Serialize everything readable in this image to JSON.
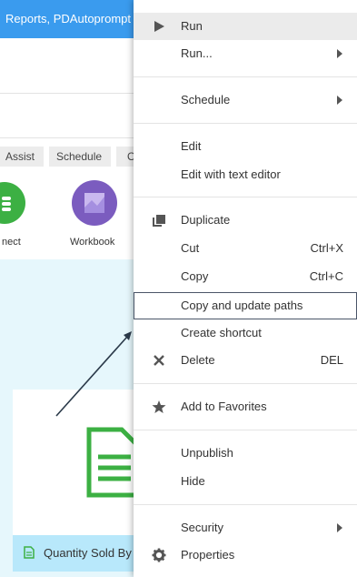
{
  "background": {
    "title": "Reports, PDAutoprompt",
    "chips": [
      "Assist",
      "Schedule",
      "O"
    ],
    "tiles": [
      {
        "label": "nect",
        "icon": "green-circle-icon",
        "color": "#3cb043"
      },
      {
        "label": "Workbook",
        "icon": "workbook-icon",
        "color": "#7b5cbf"
      }
    ],
    "card_title": "Quantity Sold By"
  },
  "menu": {
    "items": [
      {
        "label": "Run",
        "icon": "play-icon"
      },
      {
        "label": "Run...",
        "submenu": true
      },
      {
        "label": "Schedule",
        "submenu": true
      },
      {
        "label": "Edit"
      },
      {
        "label": "Edit with text editor"
      },
      {
        "label": "Duplicate",
        "icon": "duplicate-icon"
      },
      {
        "label": "Cut",
        "shortcut": "Ctrl+X"
      },
      {
        "label": "Copy",
        "shortcut": "Ctrl+C"
      },
      {
        "label": "Copy and update paths"
      },
      {
        "label": "Create shortcut"
      },
      {
        "label": "Delete",
        "icon": "close-icon",
        "shortcut": "DEL"
      },
      {
        "label": "Add to Favorites",
        "icon": "star-icon"
      },
      {
        "label": "Unpublish"
      },
      {
        "label": "Hide"
      },
      {
        "label": "Security",
        "submenu": true
      },
      {
        "label": "Properties",
        "icon": "gear-icon"
      }
    ]
  },
  "colors": {
    "title_bar": "#3a9bee",
    "menu_highlight": "#ebebeb",
    "panel_bg": "#e6f7fc",
    "card_footer": "#b8e8fb",
    "doc_green": "#3cb043"
  }
}
